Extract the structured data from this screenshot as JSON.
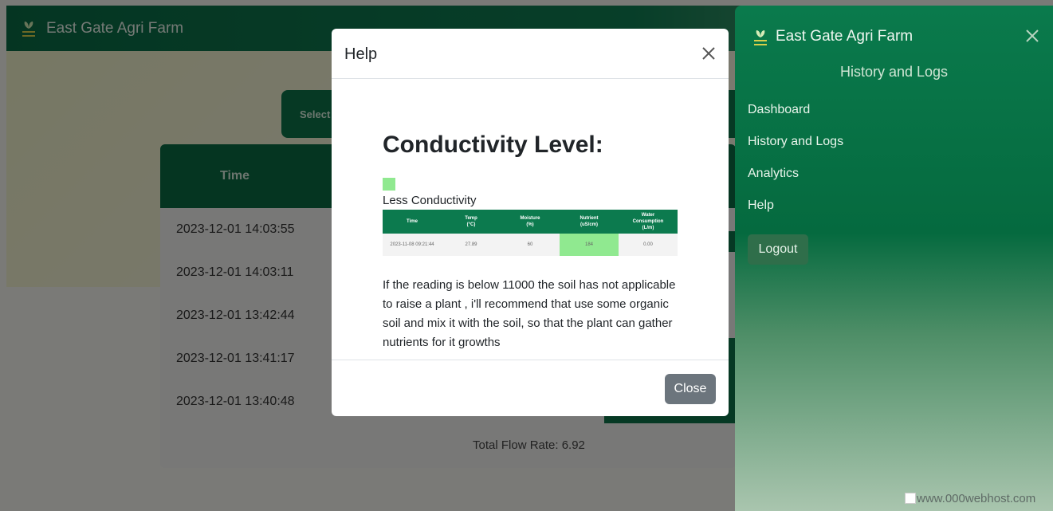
{
  "app": {
    "brand": "East Gate Agri Farm",
    "select_label": "Select",
    "table": {
      "time_header": "Time",
      "rows": [
        "2023-12-01 14:03:55",
        "2023-12-01 14:03:11",
        "2023-12-01 13:42:44",
        "2023-12-01 13:41:17",
        "2023-12-01 13:40:48"
      ]
    },
    "total_flow": "Total Flow Rate: 6.92"
  },
  "sidebar": {
    "brand": "East Gate Agri Farm",
    "subtitle": "History and Logs",
    "close_icon": "close-icon",
    "nav": [
      {
        "label": "Dashboard"
      },
      {
        "label": "History and Logs"
      },
      {
        "label": "Analytics"
      },
      {
        "label": "Help"
      }
    ],
    "logout": "Logout",
    "footer": "www.000webhost.com"
  },
  "modal": {
    "title": "Help",
    "heading": "Conductivity Level:",
    "legend": {
      "label": "Less Conductivity",
      "color": "#90e990"
    },
    "sample_table": {
      "headers": [
        "Time",
        "Temp\n(°C)",
        "Moisture\n(%)",
        "Nutrient\n(uS/cm)",
        "Water\nConsumption\n(L/m)"
      ],
      "row": [
        "2023-11-08 09:21:44",
        "27.89",
        "60",
        "184",
        "0.00"
      ]
    },
    "text": "If the reading is below 11000 the soil has not applicable to raise a plant , i'll recommend that use some organic soil and mix it with the soil, so that the plant can gather nutrients for it growths",
    "close_button": "Close"
  },
  "colors": {
    "primary_green": "#0c7248",
    "highlight": "#90e990",
    "button_gray": "#6c757d"
  }
}
